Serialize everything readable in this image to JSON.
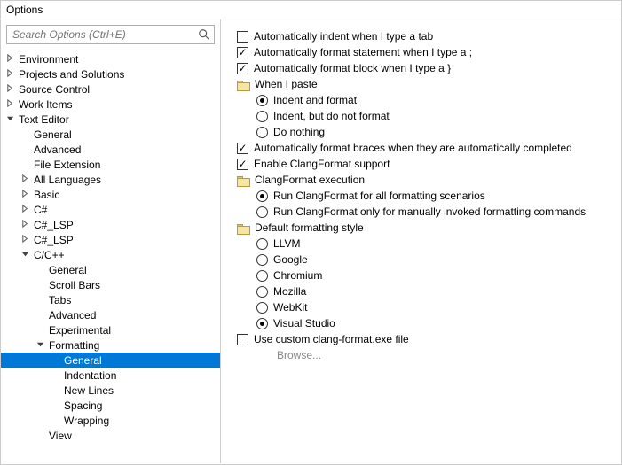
{
  "window": {
    "title": "Options"
  },
  "search": {
    "placeholder": "Search Options (Ctrl+E)"
  },
  "tree": [
    {
      "label": "Environment",
      "depth": 0,
      "arrow": "right"
    },
    {
      "label": "Projects and Solutions",
      "depth": 0,
      "arrow": "right"
    },
    {
      "label": "Source Control",
      "depth": 0,
      "arrow": "right"
    },
    {
      "label": "Work Items",
      "depth": 0,
      "arrow": "right"
    },
    {
      "label": "Text Editor",
      "depth": 0,
      "arrow": "down"
    },
    {
      "label": "General",
      "depth": 1,
      "arrow": ""
    },
    {
      "label": "Advanced",
      "depth": 1,
      "arrow": ""
    },
    {
      "label": "File Extension",
      "depth": 1,
      "arrow": ""
    },
    {
      "label": "All Languages",
      "depth": 1,
      "arrow": "right"
    },
    {
      "label": "Basic",
      "depth": 1,
      "arrow": "right"
    },
    {
      "label": "C#",
      "depth": 1,
      "arrow": "right"
    },
    {
      "label": "C#_LSP",
      "depth": 1,
      "arrow": "right"
    },
    {
      "label": "C#_LSP",
      "depth": 1,
      "arrow": "right"
    },
    {
      "label": "C/C++",
      "depth": 1,
      "arrow": "down"
    },
    {
      "label": "General",
      "depth": 2,
      "arrow": ""
    },
    {
      "label": "Scroll Bars",
      "depth": 2,
      "arrow": ""
    },
    {
      "label": "Tabs",
      "depth": 2,
      "arrow": ""
    },
    {
      "label": "Advanced",
      "depth": 2,
      "arrow": ""
    },
    {
      "label": "Experimental",
      "depth": 2,
      "arrow": ""
    },
    {
      "label": "Formatting",
      "depth": 2,
      "arrow": "down"
    },
    {
      "label": "General",
      "depth": 3,
      "arrow": "",
      "selected": true
    },
    {
      "label": "Indentation",
      "depth": 3,
      "arrow": ""
    },
    {
      "label": "New Lines",
      "depth": 3,
      "arrow": ""
    },
    {
      "label": "Spacing",
      "depth": 3,
      "arrow": ""
    },
    {
      "label": "Wrapping",
      "depth": 3,
      "arrow": ""
    },
    {
      "label": "View",
      "depth": 2,
      "arrow": ""
    }
  ],
  "options": [
    {
      "kind": "checkbox",
      "checked": false,
      "indent": 0,
      "label": "Automatically indent when I type a tab"
    },
    {
      "kind": "checkbox",
      "checked": true,
      "indent": 0,
      "label": "Automatically format statement when I type a ;"
    },
    {
      "kind": "checkbox",
      "checked": true,
      "indent": 0,
      "label": "Automatically format block when I type a }"
    },
    {
      "kind": "group",
      "indent": 0,
      "label": "When I paste"
    },
    {
      "kind": "radio",
      "checked": true,
      "indent": 1,
      "label": "Indent and format"
    },
    {
      "kind": "radio",
      "checked": false,
      "indent": 1,
      "label": "Indent, but do not format"
    },
    {
      "kind": "radio",
      "checked": false,
      "indent": 1,
      "label": "Do nothing"
    },
    {
      "kind": "checkbox",
      "checked": true,
      "indent": 0,
      "label": "Automatically format braces when they are automatically completed"
    },
    {
      "kind": "checkbox",
      "checked": true,
      "indent": 0,
      "label": "Enable ClangFormat support"
    },
    {
      "kind": "group",
      "indent": 0,
      "label": "ClangFormat execution"
    },
    {
      "kind": "radio",
      "checked": true,
      "indent": 1,
      "label": "Run ClangFormat for all formatting scenarios"
    },
    {
      "kind": "radio",
      "checked": false,
      "indent": 1,
      "label": "Run ClangFormat only for manually invoked formatting commands"
    },
    {
      "kind": "group",
      "indent": 0,
      "label": "Default formatting style"
    },
    {
      "kind": "radio",
      "checked": false,
      "indent": 1,
      "label": "LLVM"
    },
    {
      "kind": "radio",
      "checked": false,
      "indent": 1,
      "label": "Google"
    },
    {
      "kind": "radio",
      "checked": false,
      "indent": 1,
      "label": "Chromium"
    },
    {
      "kind": "radio",
      "checked": false,
      "indent": 1,
      "label": "Mozilla"
    },
    {
      "kind": "radio",
      "checked": false,
      "indent": 1,
      "label": "WebKit"
    },
    {
      "kind": "radio",
      "checked": true,
      "indent": 1,
      "label": "Visual Studio"
    },
    {
      "kind": "checkbox",
      "checked": false,
      "indent": 0,
      "label": "Use custom clang-format.exe file"
    },
    {
      "kind": "browse",
      "indent": 1,
      "label": "Browse..."
    }
  ]
}
